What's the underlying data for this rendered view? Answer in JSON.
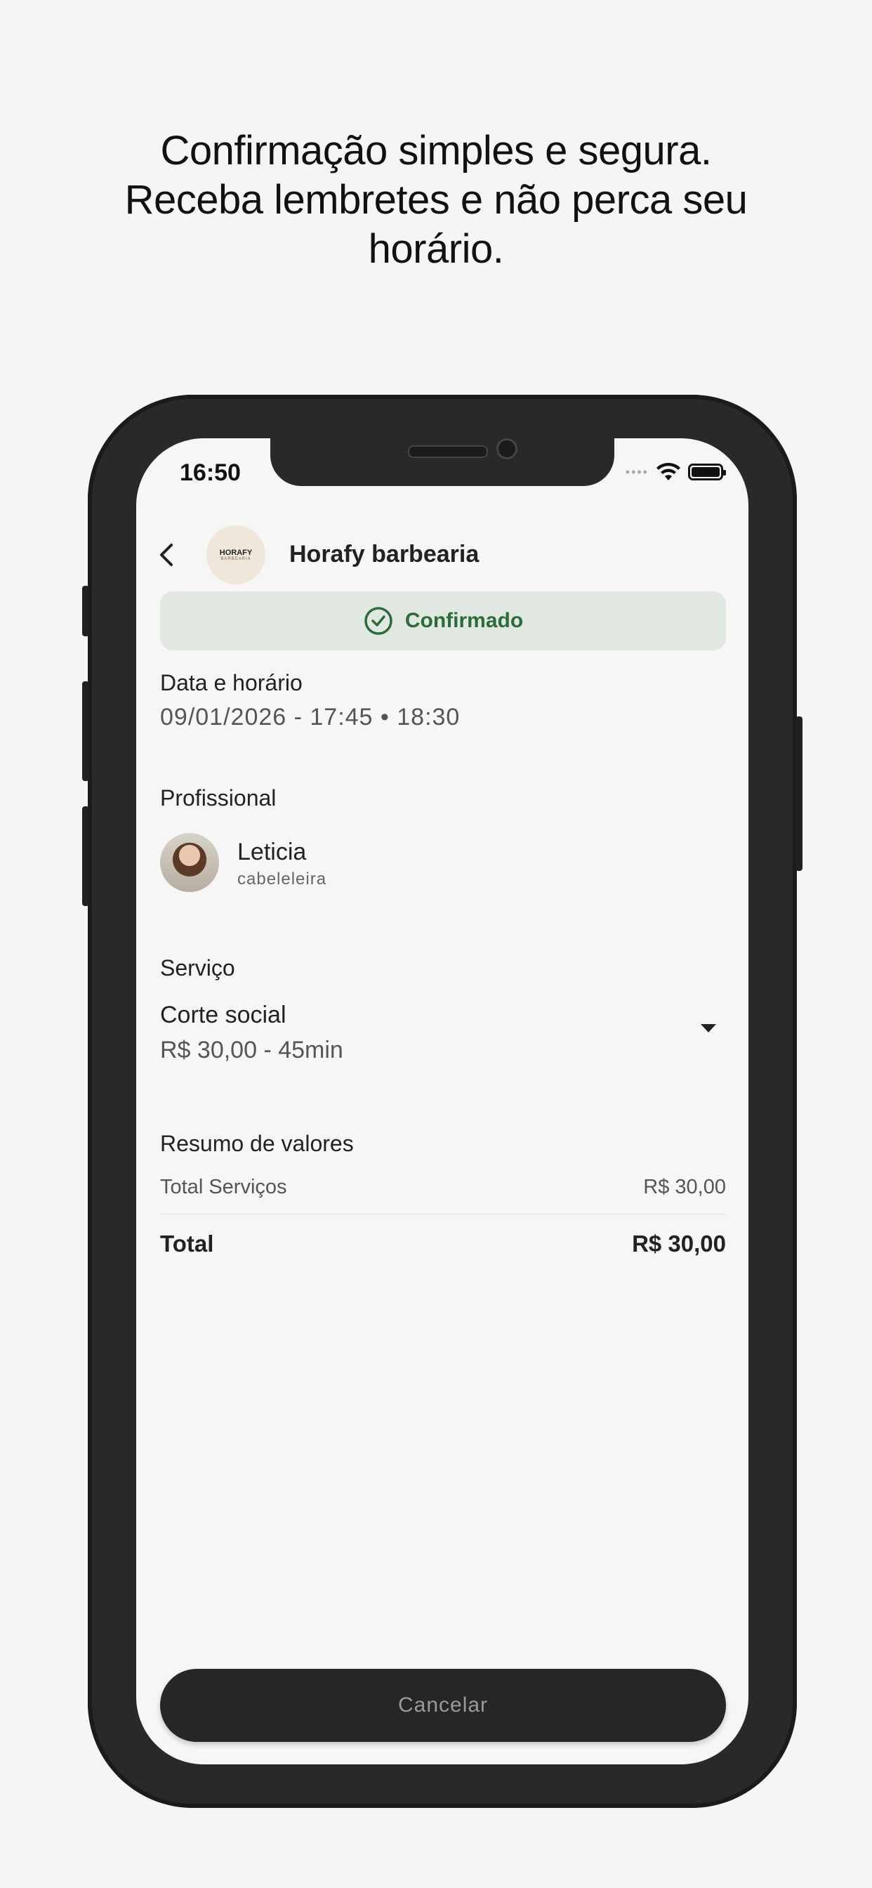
{
  "headline": {
    "line1": "Confirmação simples e segura.",
    "line2": "Receba lembretes e não perca seu",
    "line3": "horário."
  },
  "status_bar": {
    "time": "16:50",
    "signal_dots": "••••"
  },
  "header": {
    "shop_name": "Horafy barbearia",
    "logo_text": "HORAFY",
    "logo_subtext": "BARBEARIA"
  },
  "status_badge": {
    "label": "Confirmado",
    "color": "#2e6b3a"
  },
  "datetime": {
    "title": "Data e horário",
    "value": "09/01/2026 - 17:45 • 18:30"
  },
  "professional": {
    "title": "Profissional",
    "name": "Leticia",
    "role": "cabeleleira"
  },
  "service": {
    "title": "Serviço",
    "name": "Corte social",
    "price_duration": "R$ 30,00 - 45min"
  },
  "summary": {
    "title": "Resumo de valores",
    "services_label": "Total Serviços",
    "services_value": "R$ 30,00",
    "total_label": "Total",
    "total_value": "R$ 30,00"
  },
  "actions": {
    "cancel_label": "Cancelar"
  }
}
